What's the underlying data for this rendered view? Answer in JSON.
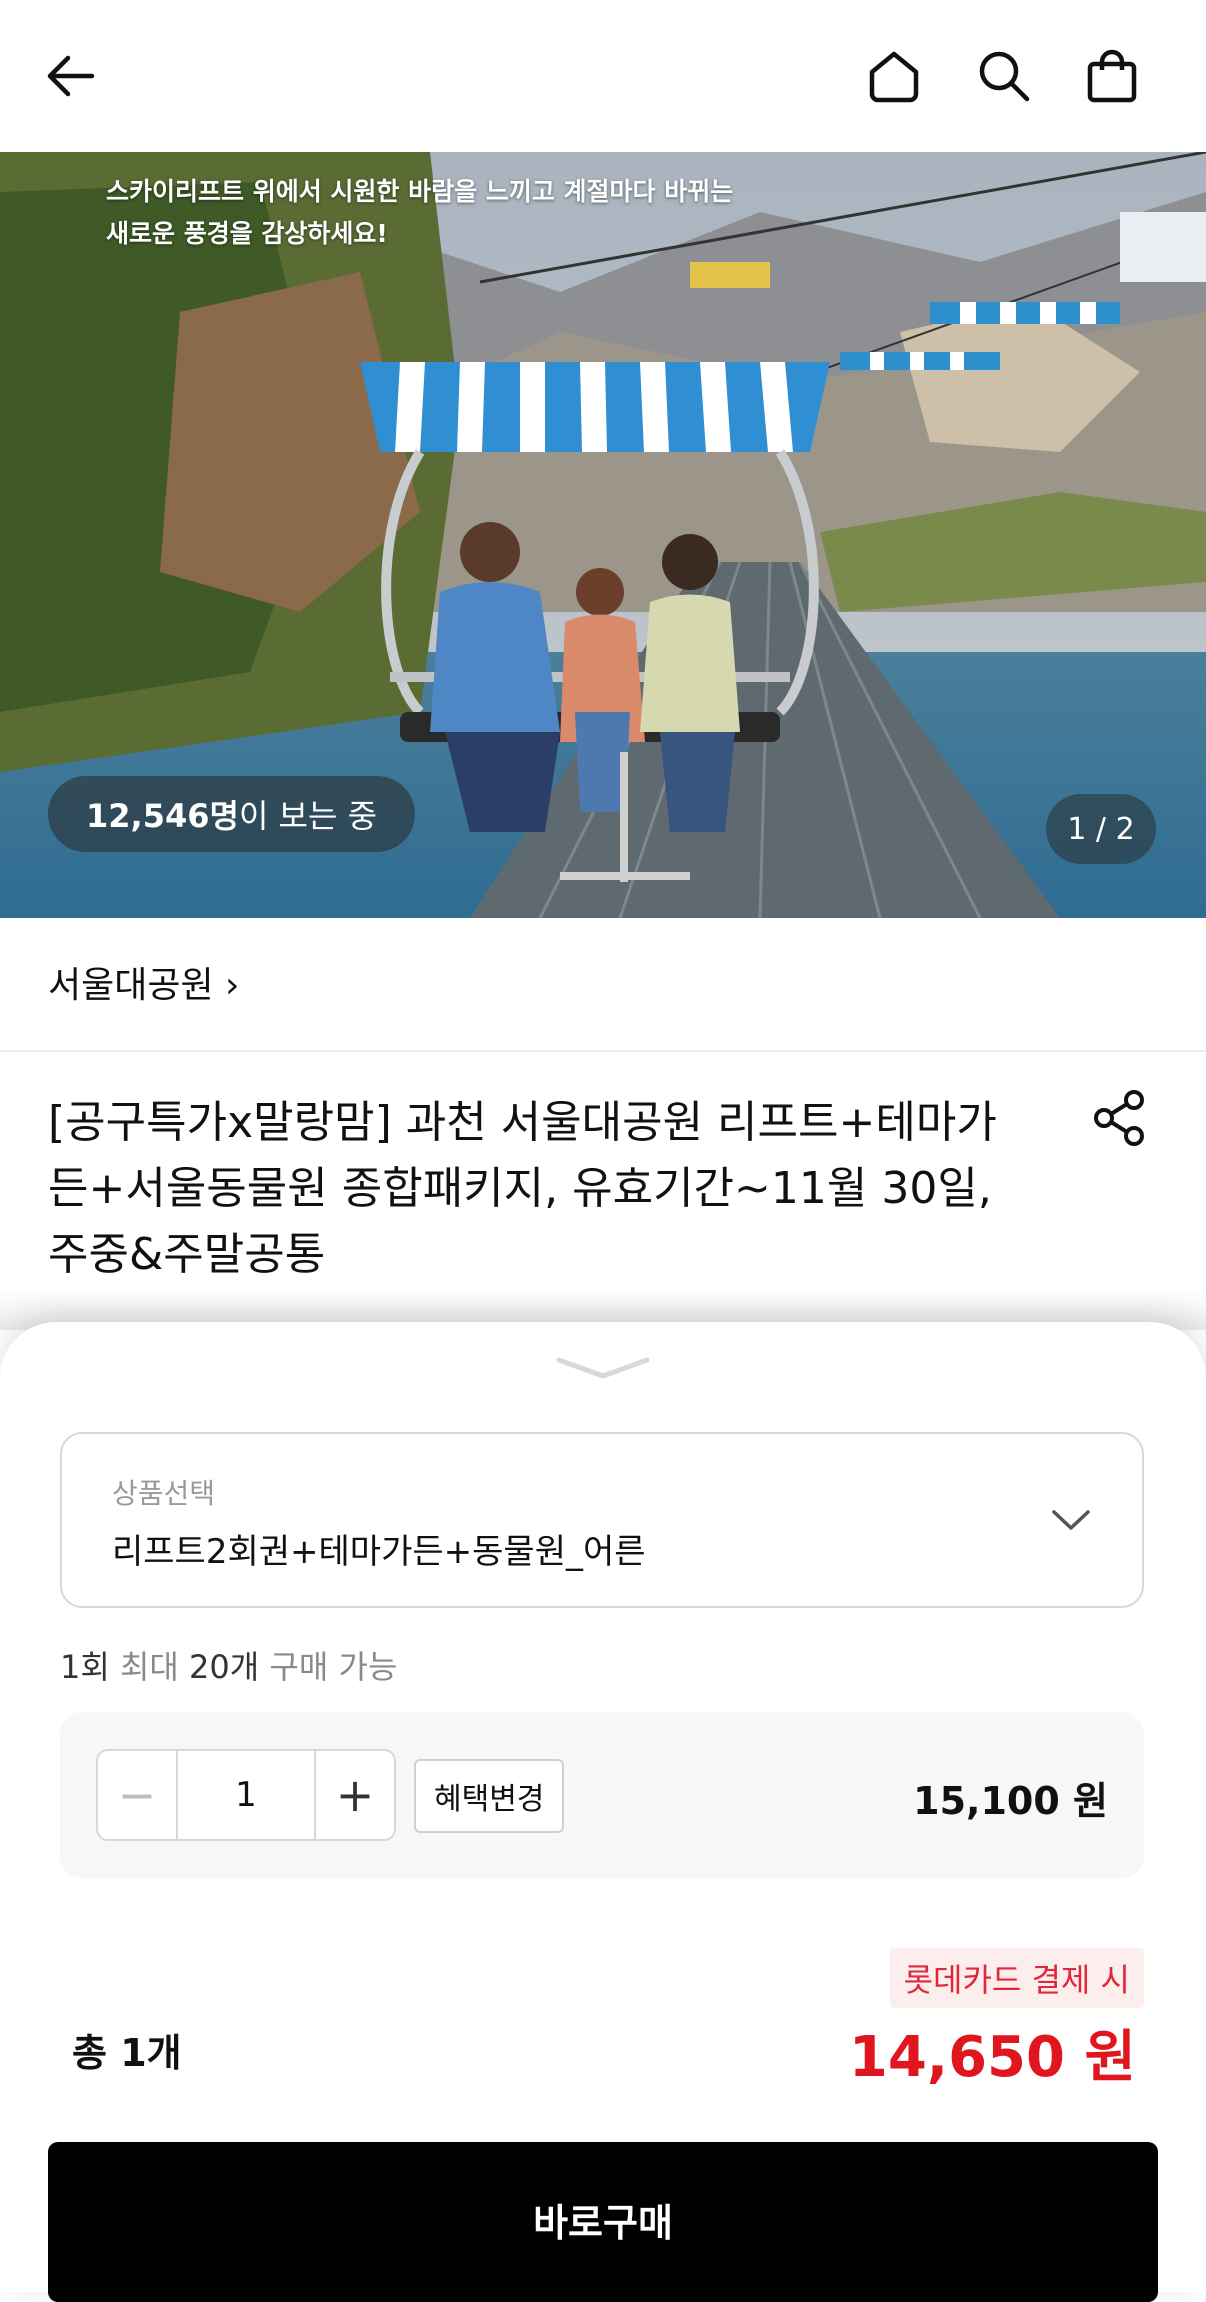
{
  "header": {
    "back_icon": "arrow-left-icon",
    "home_icon": "home-icon",
    "search_icon": "search-icon",
    "cart_icon": "shopping-bag-icon"
  },
  "hero": {
    "caption_line1": "스카이리프트 위에서 시원한 바람을 느끼고 계절마다 바뀌는",
    "caption_line2": "새로운 풍경을 감상하세요!",
    "viewers_count": "12,546명",
    "viewers_suffix": "이 보는 중",
    "pager": "1 / 2"
  },
  "product": {
    "brand": "서울대공원 ›",
    "title": "[공구특가x말랑맘] 과천 서울대공원 리프트+테마가든+서울동물원 종합패키지, 유효기간~11월 30일, 주중&주말공통",
    "share_icon": "share-icon"
  },
  "sheet": {
    "select_label": "상품선택",
    "select_value": "리프트2회권+테마가든+동물원_어른",
    "limit_prefix": "1회",
    "limit_mid": " 최대 ",
    "limit_count": "20개",
    "limit_suffix": " 구매 가능",
    "quantity": "1",
    "minus": "−",
    "plus": "+",
    "benefit_button": "혜택변경",
    "unit_price": "15,100 원",
    "card_badge": "롯데카드 결제 시",
    "total_count": "총 1개",
    "total_price": "14,650 원",
    "buy_button": "바로구매"
  },
  "colors": {
    "accent_red": "#e0161e",
    "badge_bg": "#fdeeee",
    "buy_bg": "#000000"
  }
}
